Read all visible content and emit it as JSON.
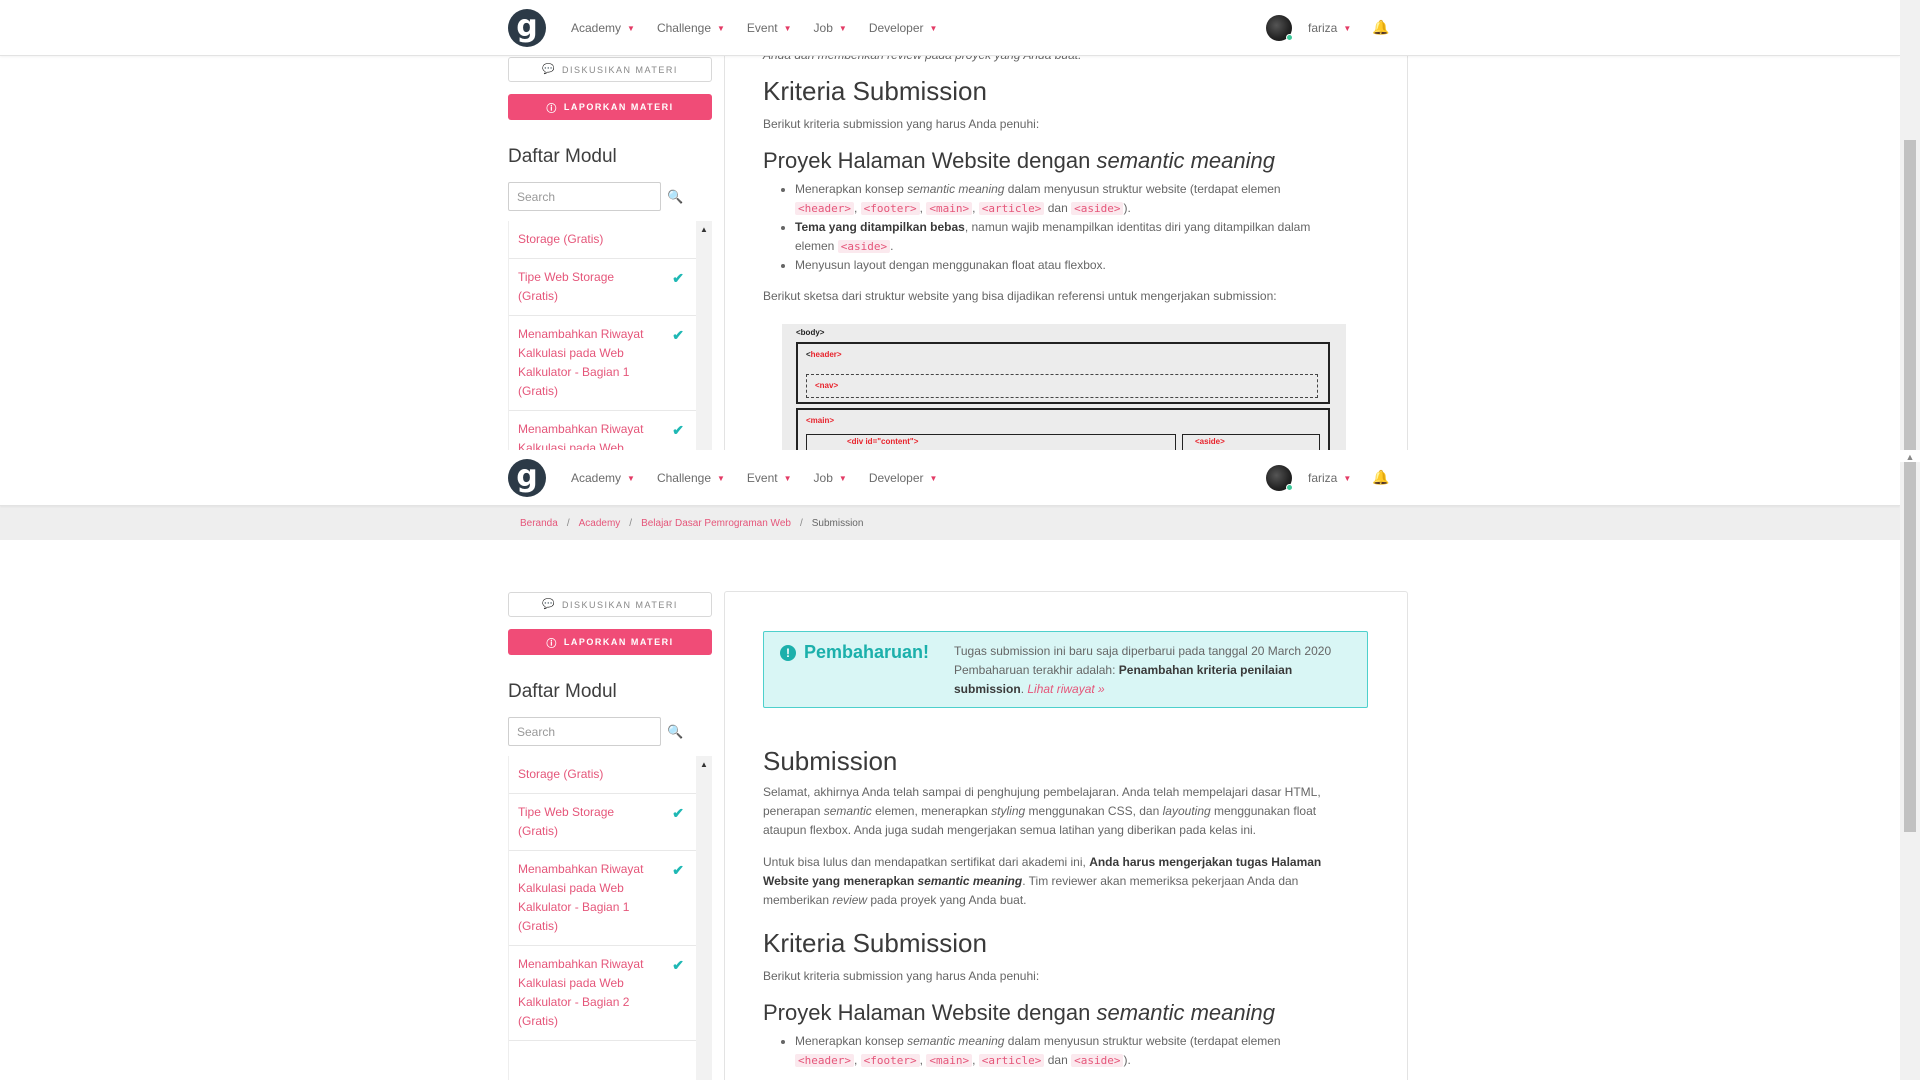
{
  "nav": {
    "logo": "g",
    "menu": [
      "Academy",
      "Challenge",
      "Event",
      "Job",
      "Developer"
    ],
    "username": "fariza"
  },
  "breadcrumb": {
    "items": [
      "Beranda",
      "Academy",
      "Belajar Dasar Pemrograman Web"
    ],
    "current": "Submission"
  },
  "sidebar": {
    "discuss_label": "DISKUSIKAN MATERI",
    "report_label": "LAPORKAN MATERI",
    "module_title": "Daftar Modul",
    "search_placeholder": "Search",
    "modules": [
      {
        "label": "Storage (Gratis)",
        "done": false
      },
      {
        "label": "Tipe Web Storage (Gratis)",
        "done": true
      },
      {
        "label": "Menambahkan Riwayat Kalkulasi pada Web Kalkulator - Bagian 1 (Gratis)",
        "done": true
      },
      {
        "label": "Menambahkan Riwayat Kalkulasi pada Web Kalkulator - Bagian 2 (Gratis)",
        "done": true
      }
    ]
  },
  "alert": {
    "title": "Pembaharuan!",
    "text_1": "Tugas submission ini baru saja diperbarui pada tanggal 20 March 2020 Pembaharuan terakhir adalah: ",
    "bold": "Penambahan kriteria penilaian submission",
    "text_2": ". ",
    "link": "Lihat riwayat »"
  },
  "content": {
    "submission_title": "Submission",
    "p1_a": "Selamat, akhirnya Anda telah sampai di penghujung pembelajaran. Anda telah mempelajari dasar HTML, penerapan ",
    "p1_em1": "semantic",
    "p1_b": " elemen, menerapkan ",
    "p1_em2": "styling",
    "p1_c": " menggunakan CSS, dan ",
    "p1_em3": "layouting",
    "p1_d": " menggunakan float ataupun flexbox. Anda juga sudah mengerjakan semua latihan yang diberikan pada kelas ini.",
    "p2_a": "Untuk bisa lulus dan mendapatkan sertifikat dari akademi ini, ",
    "p2_bold": "Anda harus mengerjakan tugas Halaman Website yang menerapkan ",
    "p2_bold_em": "semantic meaning",
    "p2_b": ". Tim reviewer akan memeriksa pekerjaan Anda dan memberikan ",
    "p2_em": "review",
    "p2_c": " pada proyek yang Anda buat.",
    "p2_top_clip": "Anda dan memberikan review pada proyek yang Anda buat.",
    "criteria_title": "Kriteria Submission",
    "criteria_intro": "Berikut kriteria submission yang harus Anda penuhi:",
    "project_title": "Proyek Halaman Website dengan ",
    "project_title_em": "semantic meaning",
    "li1_a": "Menerapkan konsep ",
    "li1_em": "semantic meaning",
    "li1_b": " dalam menyusun struktur website (terdapat elemen",
    "tags": [
      "<header>",
      "<footer>",
      "<main>",
      "<article>",
      "<aside>"
    ],
    "comma": ",",
    "and": "dan",
    "period": ").",
    "li2_bold": "Tema yang ditampilkan bebas",
    "li2_a": ", namun wajib menampilkan identitas diri yang ditampilkan dalam elemen ",
    "li2_b": ".",
    "li3": "Menyusun layout dengan menggunakan float atau flexbox.",
    "sketch_intro": "Berikut sketsa dari struktur website yang bisa dijadikan referensi untuk mengerjakan submission:"
  },
  "sketch": {
    "body": "<body>",
    "header": "<header>",
    "nav": "<nav>",
    "main": "<main>",
    "content": "<div id=\"content\">",
    "aside": "<aside>"
  },
  "colors": {
    "accent": "#f04c77",
    "link": "#e5567a",
    "teal": "#1cb0ab"
  }
}
